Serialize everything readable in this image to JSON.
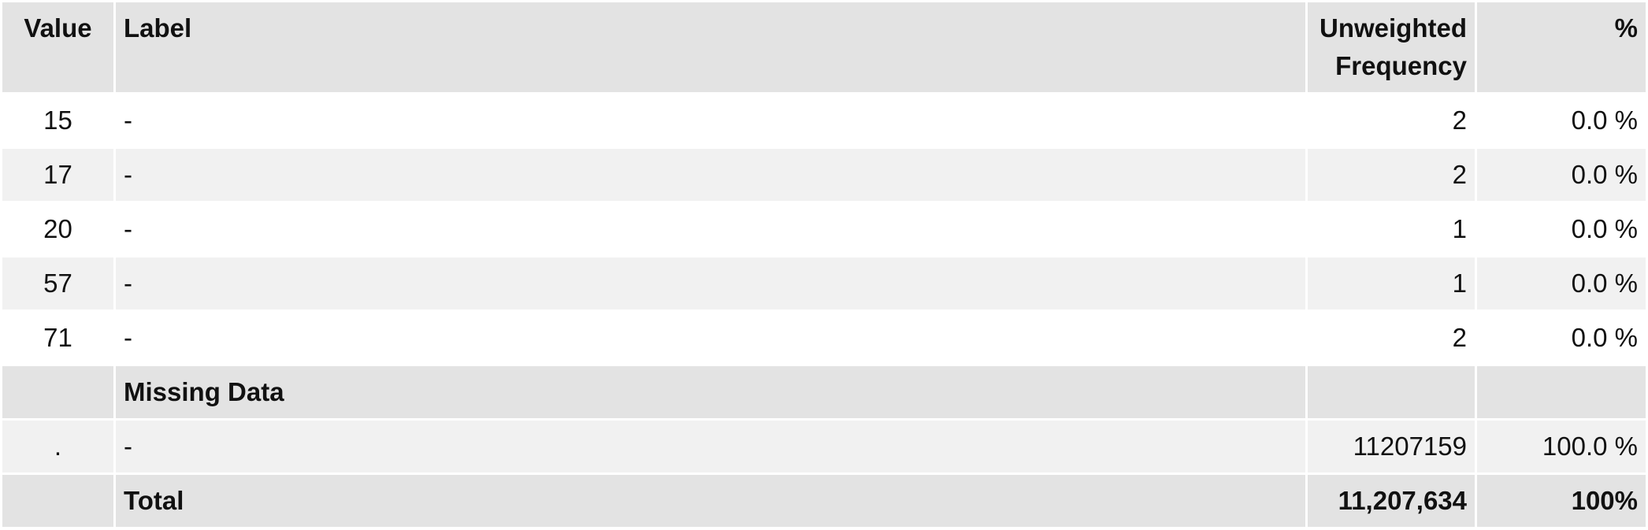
{
  "table": {
    "headers": {
      "value": "Value",
      "label": "Label",
      "freq_line1": "Unweighted",
      "freq_line2": "Frequency",
      "pct": "%"
    },
    "rows": [
      {
        "value": "15",
        "label": "-",
        "freq": "2",
        "pct": "0.0 %"
      },
      {
        "value": "17",
        "label": "-",
        "freq": "2",
        "pct": "0.0 %"
      },
      {
        "value": "20",
        "label": "-",
        "freq": "1",
        "pct": "0.0 %"
      },
      {
        "value": "57",
        "label": "-",
        "freq": "1",
        "pct": "0.0 %"
      },
      {
        "value": "71",
        "label": "-",
        "freq": "2",
        "pct": "0.0 %"
      }
    ],
    "missing_section": {
      "title": "Missing Data",
      "row": {
        "value": ".",
        "label": "-",
        "freq": "11207159",
        "pct": "100.0 %"
      }
    },
    "total": {
      "label": "Total",
      "freq": "11,207,634",
      "pct": "100%"
    }
  },
  "colors": {
    "header_bg": "#e3e3e3",
    "row_alt_bg": "#f1f1f1",
    "row_bg": "#ffffff"
  }
}
